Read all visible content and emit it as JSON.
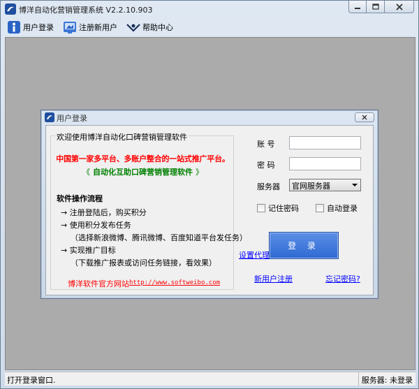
{
  "window": {
    "title": "博洋自动化营销管理系统 V2.2.10.903"
  },
  "toolbar": {
    "items": [
      {
        "label": "用户登录",
        "icon": "user-info-icon"
      },
      {
        "label": "注册新用户",
        "icon": "register-icon"
      },
      {
        "label": "帮助中心",
        "icon": "help-icon"
      }
    ]
  },
  "dialog": {
    "title": "用户登录",
    "group_title": "欢迎使用博洋自动化口碑营销管理软件",
    "headline": "中国第一家多平台、多账户整合的一站式推广平台。",
    "slogan_open": "《",
    "slogan": "自动化互助口碑营销管理软件",
    "slogan_close": "》",
    "section_title": "软件操作流程",
    "steps": [
      "→  注册登陆后，购买积分",
      "→  使用积分发布任务",
      "（选择新浪微博、腾讯微博、百度知道平台发任务）",
      "→  实现推广目标",
      "（下载推广报表或访问任务链接，看效果）"
    ],
    "site_label": "博洋软件官方网站",
    "site_url": "http://www.softweibo.com",
    "account_label": "账  号",
    "account_value": "",
    "password_label": "密  码",
    "password_value": "",
    "server_label": "服务器",
    "server_selected": "官网服务器",
    "remember_label": "记住密码",
    "autologin_label": "自动登录",
    "proxy_link": "设置代理",
    "login_button": "登 录",
    "register_link": "新用户注册",
    "forgot_link": "忘记密码?"
  },
  "status": {
    "left": "打开登录窗口.",
    "right": "服务器: 未登录"
  },
  "colors": {
    "accent_red": "#ff0000",
    "accent_green": "#008000",
    "link_blue": "#0000ff",
    "login_button": "#3a73d8"
  }
}
